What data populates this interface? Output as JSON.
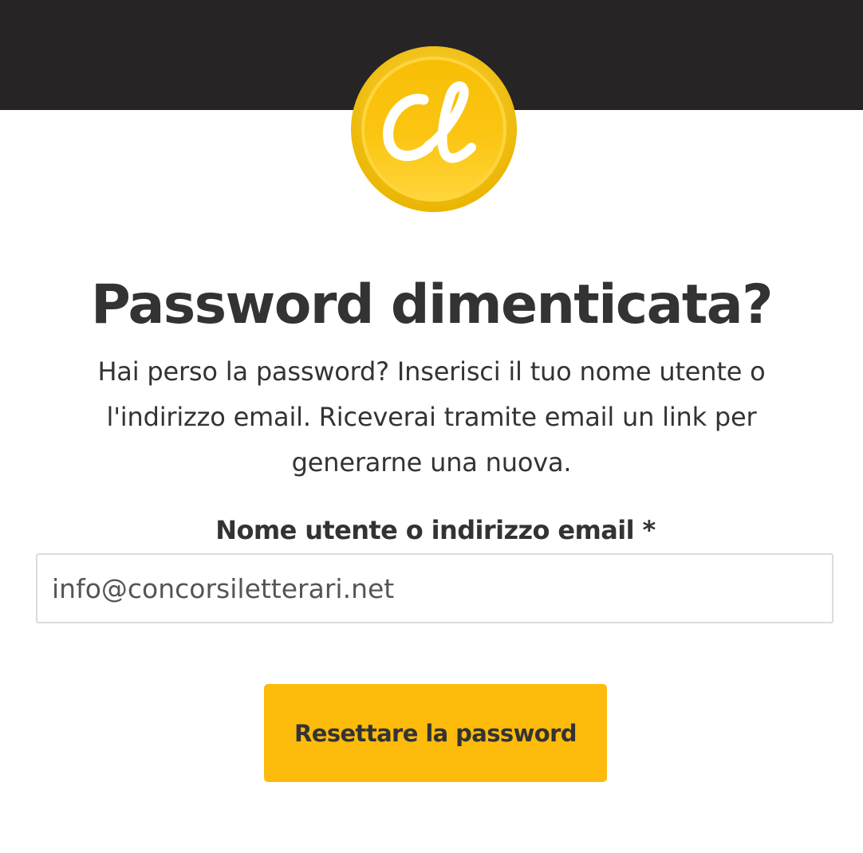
{
  "logo": {
    "text": "Cl",
    "color": "#fdbb0c"
  },
  "title": "Password dimenticata?",
  "description": "Hai perso la password? Inserisci il tuo nome utente o l'indirizzo email. Riceverai tramite email un link per generarne una nuova.",
  "form": {
    "label": "Nome utente o indirizzo email *",
    "input_value": "info@concorsiletterari.net",
    "submit_label": "Resettare la password"
  },
  "colors": {
    "header_bar": "#262425",
    "accent": "#fdbb0c",
    "text": "#333333"
  }
}
